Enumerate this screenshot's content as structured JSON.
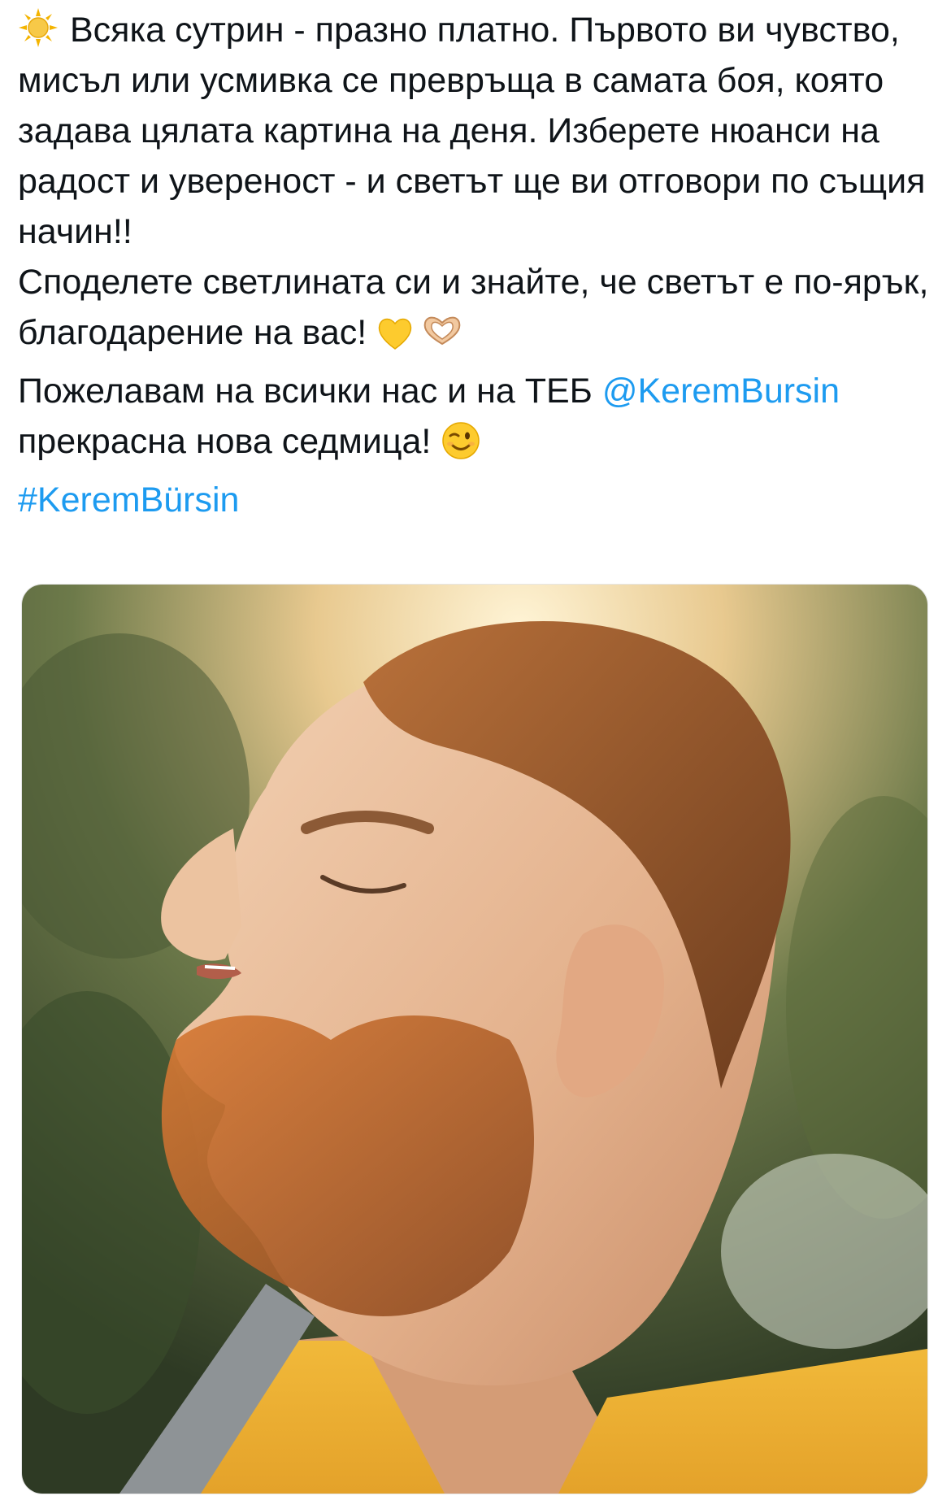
{
  "tweet": {
    "line1": "Всяка сутрин - празно платно. Първото ви чувство, мисъл или усмивка се превръща в самата боя, която задава цялата картина на деня. Изберете нюанси на радост и увереност - и светът ще ви отговори по същия начин!!",
    "line2": "Споделете светлината си и знайте, че светът е по-ярък, благодарение на вас!",
    "line3_before": "Пожелавам на всички нас и на ТЕБ ",
    "mention": "@KeremBursin",
    "line3_after": " прекрасна нова седмица!",
    "hashtag": "#KeremBürsin"
  },
  "icons": {
    "sun": "sun-emoji",
    "heart": "yellow-heart-emoji",
    "hands": "heart-hands-emoji",
    "wink": "winking-face-emoji"
  },
  "colors": {
    "text": "#0f1419",
    "link": "#1d9bf0"
  },
  "media": {
    "type": "photo",
    "subject": "man in profile with eyes closed, sunlit"
  }
}
